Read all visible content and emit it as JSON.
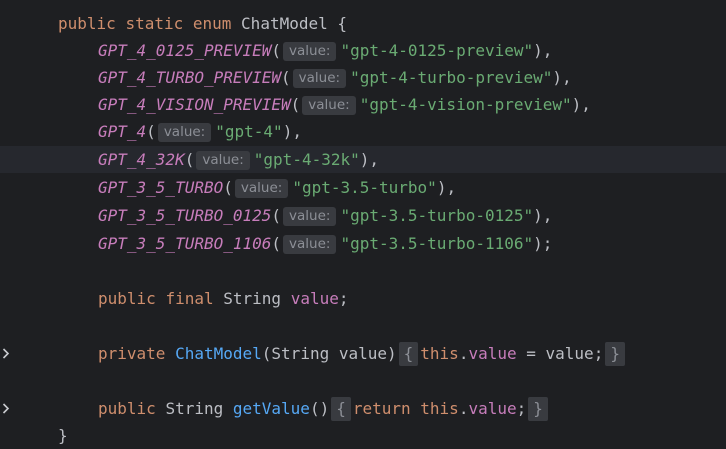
{
  "editor": {
    "lines": {
      "enum_decl": {
        "kw_public": "public",
        "kw_static": "static",
        "kw_enum": "enum",
        "name": "ChatModel",
        "brace": "{"
      },
      "c1": {
        "name": "GPT_4_0125_PREVIEW",
        "hint": "value:",
        "value": "\"gpt-4-0125-preview\"",
        "end": "),"
      },
      "c2": {
        "name": "GPT_4_TURBO_PREVIEW",
        "hint": "value:",
        "value": "\"gpt-4-turbo-preview\"",
        "end": "),"
      },
      "c3": {
        "name": "GPT_4_VISION_PREVIEW",
        "hint": "value:",
        "value": "\"gpt-4-vision-preview\"",
        "end": "),"
      },
      "c4": {
        "name": "GPT_4",
        "hint": "value:",
        "value": "\"gpt-4\"",
        "end": "),"
      },
      "c5": {
        "name": "GPT_4_32K",
        "hint": "value:",
        "value": "\"gpt-4-32k\"",
        "end": "),"
      },
      "c6": {
        "name": "GPT_3_5_TURBO",
        "hint": "value:",
        "value": "\"gpt-3.5-turbo\"",
        "end": "),"
      },
      "c7": {
        "name": "GPT_3_5_TURBO_0125",
        "hint": "value:",
        "value": "\"gpt-3.5-turbo-0125\"",
        "end": "),"
      },
      "c8": {
        "name": "GPT_3_5_TURBO_1106",
        "hint": "value:",
        "value": "\"gpt-3.5-turbo-1106\"",
        "end": ");"
      },
      "field": {
        "kw_public": "public",
        "kw_final": "final",
        "type": "String",
        "name": "value",
        "end": ";"
      },
      "ctor": {
        "kw_private": "private",
        "name": "ChatModel",
        "params": "(String value)",
        "open": "{",
        "kw_this": "this",
        "dot": ".",
        "field": "value",
        "assign": " = value;",
        "close": "}"
      },
      "getter": {
        "kw_public": "public",
        "type": "String",
        "name": "getValue",
        "parens": "()",
        "open": "{",
        "kw_return": "return",
        "kw_this": "this",
        "dot": ".",
        "field": "value",
        "semi": ";",
        "close": "}"
      },
      "closing": {
        "brace": "}"
      }
    },
    "icons": {
      "fold": "chevron-right-icon"
    },
    "colors": {
      "background": "#1e1f22",
      "current_line": "#26282e",
      "keyword": "#cf8e6d",
      "enum_constant": "#c77dbb",
      "string": "#6aab73",
      "method": "#56a8f5",
      "plain": "#bcbec4",
      "hint_bg": "#393b40",
      "hint_text": "#8c8f96"
    }
  }
}
